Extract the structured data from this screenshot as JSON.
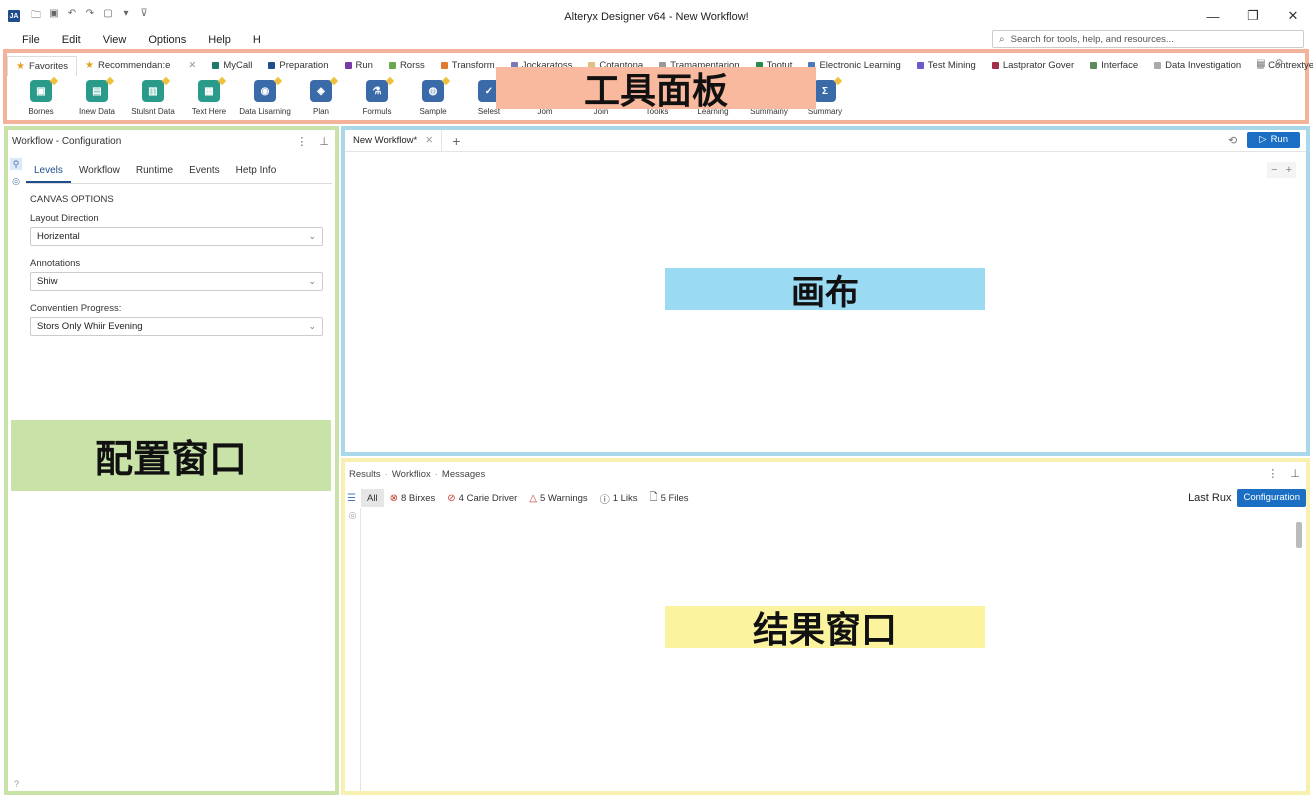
{
  "window": {
    "title": "Alteryx Designer v64 - New Workflow!",
    "logo": "JA",
    "minimize": "—",
    "restore": "❐",
    "close": "✕"
  },
  "menu": [
    "File",
    "Edit",
    "View",
    "Options",
    "Help",
    "H"
  ],
  "search": {
    "placeholder": "Search for tools, help, and resources..."
  },
  "palette": {
    "categories": [
      {
        "label": "Favorites",
        "color": "#e0a020"
      },
      {
        "label": "Recommendan:e",
        "color": "#e0a020"
      },
      {
        "label": "MyCall",
        "color": "#1f7a6a"
      },
      {
        "label": "Preparation",
        "color": "#1f4e8c"
      },
      {
        "label": "Run",
        "color": "#7a3aa8"
      },
      {
        "label": "Rorss",
        "color": "#6aa84f"
      },
      {
        "label": "Transform",
        "color": "#e07a30"
      },
      {
        "label": "Jockaratoss",
        "color": "#7a7ab8"
      },
      {
        "label": "Cotantona",
        "color": "#e0c080"
      },
      {
        "label": "Tramamentarion",
        "color": "#999999"
      },
      {
        "label": "Tootut",
        "color": "#2a8a4a"
      },
      {
        "label": "Electronic Learning",
        "color": "#4a7ab8"
      },
      {
        "label": "Test Mining",
        "color": "#6a5acd"
      },
      {
        "label": "Lastprator Gover",
        "color": "#a0304a"
      },
      {
        "label": "Interface",
        "color": "#5a8a5a"
      },
      {
        "label": "Data Investigation",
        "color": "#aaaaaa"
      },
      {
        "label": "Contrextyes",
        "color": "#bbbbbb"
      }
    ],
    "tools": [
      {
        "label": "Bornes",
        "color": "#2a9a8a",
        "glyph": "▣"
      },
      {
        "label": "Inew Data",
        "color": "#2a9a8a",
        "glyph": "▤"
      },
      {
        "label": "Stulsnt Data",
        "color": "#2a9a8a",
        "glyph": "▥"
      },
      {
        "label": "Text Here",
        "color": "#2a9a8a",
        "glyph": "▦"
      },
      {
        "label": "Data Lisarning",
        "color": "#3a6aa8",
        "glyph": "◉"
      },
      {
        "label": "Plan",
        "color": "#3a6aa8",
        "glyph": "◈"
      },
      {
        "label": "Formuls",
        "color": "#3a6aa8",
        "glyph": "⚗"
      },
      {
        "label": "Sample",
        "color": "#3a6aa8",
        "glyph": "◍"
      },
      {
        "label": "Selest",
        "color": "#3a6aa8",
        "glyph": "✓"
      },
      {
        "label": "Jom",
        "color": "#3a6aa8",
        "glyph": "⋈"
      },
      {
        "label": "Join",
        "color": "#3a6aa8",
        "glyph": "⋈"
      },
      {
        "label": "Toolks",
        "color": "#3a6aa8",
        "glyph": "⚙"
      },
      {
        "label": "Learning",
        "color": "#3a6aa8",
        "glyph": "◎"
      },
      {
        "label": "Summainy",
        "color": "#3a6aa8",
        "glyph": "Σ"
      },
      {
        "label": "Summary",
        "color": "#3a6aa8",
        "glyph": "Σ"
      }
    ],
    "overlay": "工具面板"
  },
  "config": {
    "header": "Workflow - Configuration",
    "tabs": [
      "Levels",
      "Workflow",
      "Runtime",
      "Events",
      "Hetp Info"
    ],
    "section": "CANVAS OPTIONS",
    "fields": [
      {
        "label": "Layout Direction",
        "value": "Horizental"
      },
      {
        "label": "Annotations",
        "value": "Shiw"
      },
      {
        "label": "Conventien Progress:",
        "value": "Stors Only Whiir Evening"
      }
    ],
    "overlay": "配置窗口"
  },
  "canvas": {
    "tab": "New Workflow*",
    "run_label": "Run",
    "overlay": "画布"
  },
  "results": {
    "crumbs": [
      "Results",
      "Workfliox",
      "Messages"
    ],
    "filters": {
      "all": "All",
      "errors": "8 Birxes",
      "conv": "4 Carie Driver",
      "warnings": "5 Warnings",
      "info": "1 Liks",
      "files": "5 Files"
    },
    "last_run": "Last Rux",
    "config_btn": "Configuration",
    "overlay": "结果窗口"
  },
  "colors": {
    "palette_border": "#f2b39a",
    "config_border": "#c8e2a8",
    "canvas_border": "#a8d8ea",
    "results_border": "#f7f0b0",
    "accent": "#1a6fc4"
  }
}
